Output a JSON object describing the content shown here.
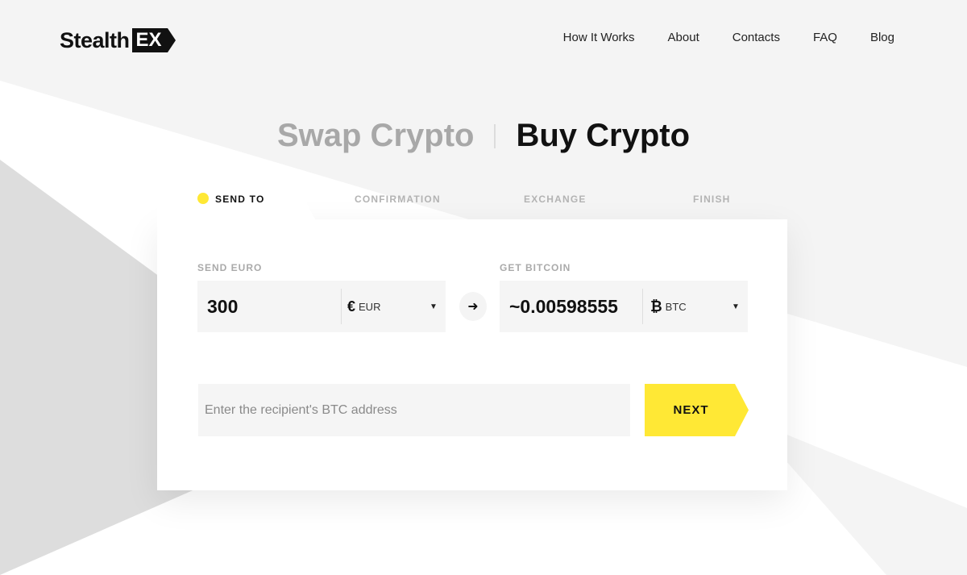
{
  "brand": {
    "name_main": "Stealth",
    "name_badge": "EX"
  },
  "nav": {
    "items": [
      "How It Works",
      "About",
      "Contacts",
      "FAQ",
      "Blog"
    ]
  },
  "titles": {
    "swap": "Swap Crypto",
    "buy": "Buy Crypto"
  },
  "steps": [
    "SEND TO",
    "CONFIRMATION",
    "EXCHANGE",
    "FINISH"
  ],
  "active_step": "SEND TO",
  "send": {
    "label": "SEND EURO",
    "amount": "300",
    "currency_symbol": "€",
    "currency_code": "EUR",
    "caret": "▼"
  },
  "swap_icon": "arrow-right-icon",
  "swap_glyph": "➜",
  "get": {
    "label": "GET BITCOIN",
    "amount": "~0.00598555",
    "currency_symbol": "₿",
    "currency_code": "BTC",
    "caret": "▼"
  },
  "address": {
    "placeholder": "Enter the recipient's BTC address",
    "value": ""
  },
  "next_button": {
    "label": "NEXT"
  },
  "colors": {
    "accent": "#FFE835",
    "background": "#F4F4F4",
    "shape_gray": "#DDDDDD",
    "text": "#111111"
  }
}
